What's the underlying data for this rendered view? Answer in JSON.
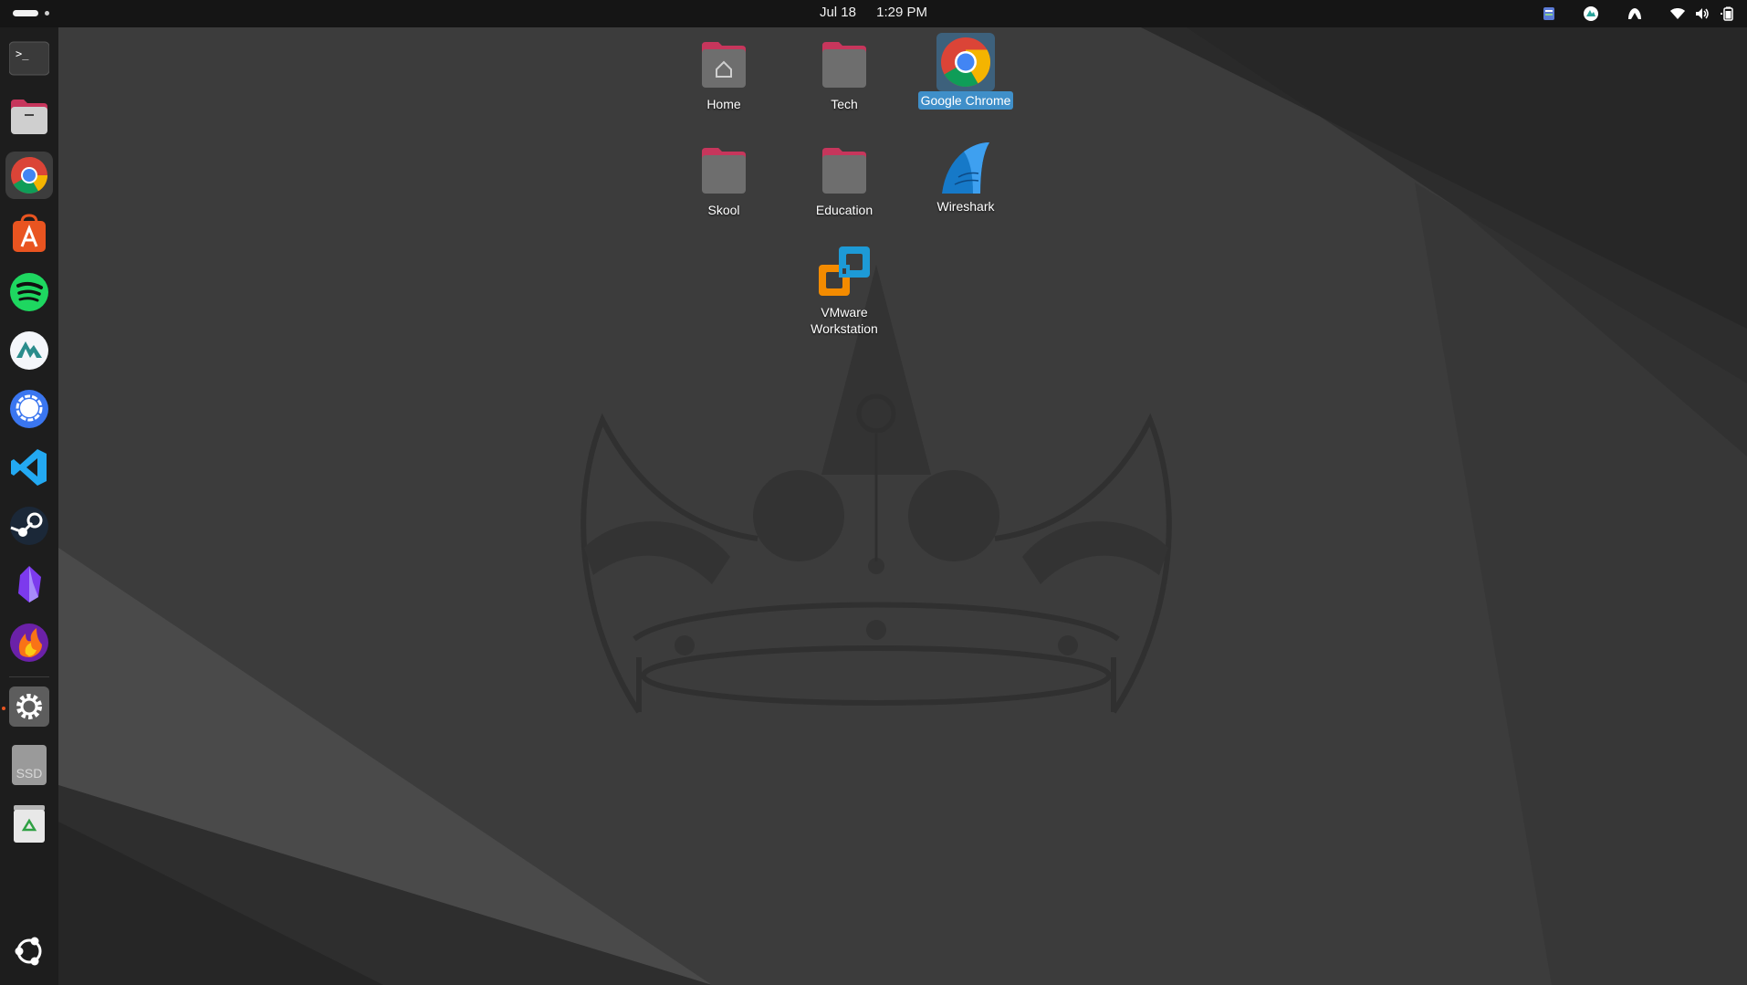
{
  "topbar": {
    "date": "Jul 18",
    "time": "1:29 PM",
    "tray_icons": [
      "notes-app-icon",
      "vpn-status-icon",
      "nordvpn-tray-icon",
      "wifi-icon",
      "volume-icon",
      "battery-icon"
    ]
  },
  "dock": {
    "items": [
      {
        "name": "terminal",
        "icon": "terminal-icon"
      },
      {
        "name": "files",
        "icon": "files-icon"
      },
      {
        "name": "google-chrome",
        "icon": "chrome-icon",
        "active": true
      },
      {
        "name": "app-center",
        "icon": "app-center-icon"
      },
      {
        "name": "spotify",
        "icon": "spotify-icon"
      },
      {
        "name": "nordvpn",
        "icon": "nordvpn-icon"
      },
      {
        "name": "signal",
        "icon": "signal-icon"
      },
      {
        "name": "vscode",
        "icon": "vscode-icon"
      },
      {
        "name": "steam",
        "icon": "steam-icon"
      },
      {
        "name": "obsidian",
        "icon": "obsidian-icon"
      },
      {
        "name": "firefox-dev",
        "icon": "flame-icon"
      },
      {
        "name": "settings",
        "icon": "gear-icon"
      },
      {
        "name": "ssd-drive",
        "icon": "drive-icon",
        "label": "SSD"
      },
      {
        "name": "trash",
        "icon": "trash-icon"
      },
      {
        "name": "show-apps",
        "icon": "ubuntu-logo-icon"
      }
    ]
  },
  "desktop": {
    "icons": [
      {
        "label": "Home",
        "icon": "home-folder-icon"
      },
      {
        "label": "Tech",
        "icon": "folder-icon"
      },
      {
        "label": "Google Chrome",
        "icon": "chrome-icon",
        "selected": true
      },
      {
        "label": "Skool",
        "icon": "folder-icon"
      },
      {
        "label": "Education",
        "icon": "folder-icon"
      },
      {
        "label": "Wireshark",
        "icon": "wireshark-icon"
      },
      {
        "label": "VMware Workstation",
        "icon": "vmware-icon"
      }
    ]
  },
  "colors": {
    "accent": "#e95420",
    "selection": "#3f8fc9",
    "panel": "#151515",
    "dock": "#1d1d1d",
    "wallpaper": "#3b3b3b"
  }
}
